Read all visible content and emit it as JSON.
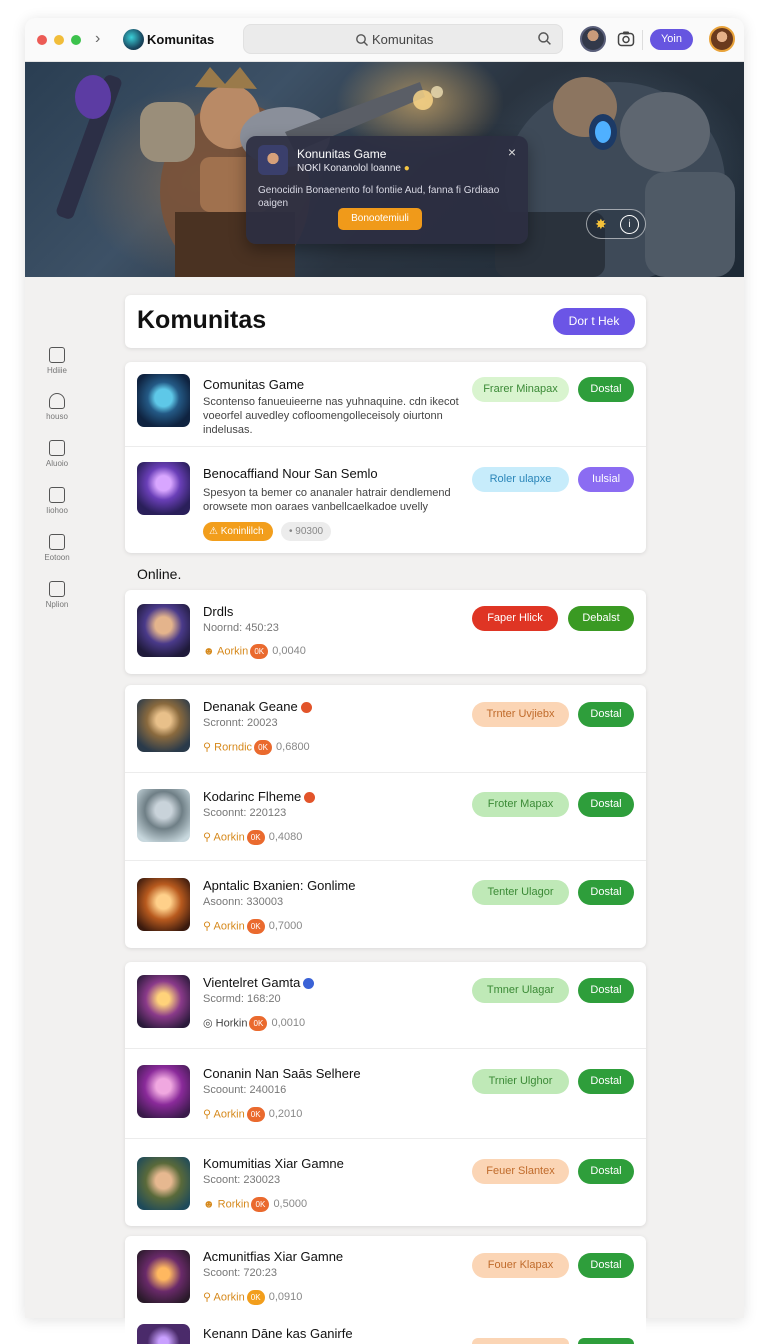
{
  "topbar": {
    "app_title": "Komunitas",
    "search_text": "Komunitas",
    "button_label": "Yoin"
  },
  "hero": {
    "popup": {
      "title": "Konunitas Game",
      "subtitle": "NOKl Konanolol loanne",
      "body": "Genocidin Bonaenento fol fontiie Aud, fanna fi Grdiaao oaigen",
      "button": "Bonootemiuli",
      "close": "×"
    },
    "controls": {
      "icon1": "puzzle-icon",
      "icon2": "info-icon"
    }
  },
  "sidebar": {
    "items": [
      {
        "label": "Hdiiie",
        "icon": "home-icon"
      },
      {
        "label": "houso",
        "icon": "bell-icon"
      },
      {
        "label": "Aluoio",
        "icon": "message-icon"
      },
      {
        "label": "Iiohoo",
        "icon": "image-icon"
      },
      {
        "label": "Eotoon",
        "icon": "shop-icon"
      },
      {
        "label": "Nplion",
        "icon": "settings-icon"
      }
    ]
  },
  "main": {
    "title": "Komunitas",
    "title_button": "Dor t Hek",
    "featured": [
      {
        "name": "Comunitas Game",
        "desc": "Scontenso fanueuieerne nas yuhnaquine. cdn ikecot voeorfel auvedley cofloomengolleceisoly oiurtonn indelusas.",
        "btn_a": "Frarer Minapax",
        "btn_b": "Dostal"
      },
      {
        "name": "Benocaffiand Nour San Semlo",
        "desc": "Spesyon ta bemer co ananaler hatrair dendlemend orowsete mon oaraes vanbellcaelkadoe uvelly",
        "btn_a": "Roler ulapxe",
        "btn_b": "Iulsial",
        "tag_label": "Koninlilch",
        "tag_count": "90300"
      }
    ],
    "section_label": "Online.",
    "online_single": {
      "name": "Drdls",
      "sub": "Noornd: 450:23",
      "meta": "Aorkin",
      "meta_badge": "0K",
      "meta_count": "0,0040",
      "btn_a": "Faper Hlick",
      "btn_b": "Debalst"
    },
    "group1": [
      {
        "name": "Denanak Geane",
        "sub": "Scronnt: 20023",
        "meta": "Rorndic",
        "meta_badge": "0K",
        "meta_count": "0,6800",
        "btn_a": "Trnter Uvjiebx",
        "btn_b": "Dostal"
      },
      {
        "name": "Kodarinc Flheme",
        "sub": "Scoonnt: 220123",
        "meta": "Aorkin",
        "meta_badge": "0K",
        "meta_count": "0,4080",
        "btn_a": "Froter Mapax",
        "btn_b": "Dostal"
      },
      {
        "name": "Apntalic Bxanien: Gonlime",
        "sub": "Asoonn: 330003",
        "meta": "Aorkin",
        "meta_badge": "0K",
        "meta_count": "0,7000",
        "btn_a": "Tenter Ulagor",
        "btn_b": "Dostal"
      }
    ],
    "group2": [
      {
        "name": "Vientelret Gamta",
        "sub": "Scormd: 168:20",
        "meta": "Horkin",
        "meta_badge": "0K",
        "meta_count": "0,0010",
        "btn_a": "Tmner Ulagar",
        "btn_b": "Dostal"
      },
      {
        "name": "Conanin Nan Saās Selhere",
        "sub": "Scoount: 240016",
        "meta": "Aorkin",
        "meta_badge": "0K",
        "meta_count": "0,2010",
        "btn_a": "Trnier Ulghor",
        "btn_b": "Dostal"
      },
      {
        "name": "Komumitias Xiar Gamne",
        "sub": "Scoont: 230023",
        "meta": "Rorkin",
        "meta_badge": "0K",
        "meta_count": "0,5000",
        "btn_a": "Feuer Slantex",
        "btn_b": "Dostal"
      }
    ],
    "group3": [
      {
        "name": "Acmunitfias Xiar Gamne",
        "sub": "Scoont: 720:23",
        "meta": "Aorkin",
        "meta_badge": "0K",
        "meta_count": "0,0910",
        "btn_a": "Fouer Klapax",
        "btn_b": "Dostal"
      }
    ],
    "partial_name": "Kenann Dāne kas Ganirfe"
  },
  "colors": {
    "accent_purple": "#6b55e6",
    "green": "#2e9e3b",
    "orange": "#f29e1c",
    "red": "#df3524"
  }
}
